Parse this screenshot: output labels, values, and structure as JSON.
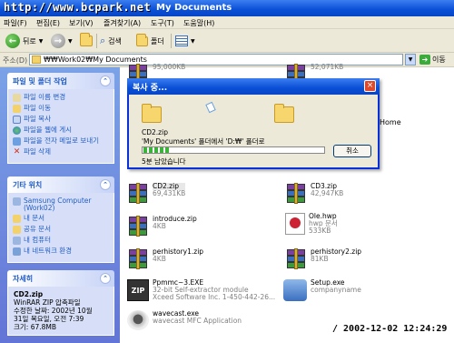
{
  "window": {
    "watermark": "http://www.bcpark.net",
    "title": "My Documents"
  },
  "menu": [
    "파일(F)",
    "편집(E)",
    "보기(V)",
    "즐겨찾기(A)",
    "도구(T)",
    "도움말(H)"
  ],
  "toolbar": {
    "back_label": "뒤로",
    "search_label": "검색",
    "folders_label": "폴더"
  },
  "address": {
    "label": "주소(D)",
    "value": "₩₩Work02₩My Documents",
    "go_label": "이동"
  },
  "left_pane": {
    "tasks": {
      "title": "파일 및 폴더 작업",
      "items": [
        "파일 이름 변경",
        "파일 이동",
        "파일 복사",
        "파일을 웹에 게시",
        "파일을 전자 메일로 보내기",
        "파일 삭제"
      ]
    },
    "other_places": {
      "title": "기타 위치",
      "items": [
        "Samsung Computer (Work02)",
        "내 문서",
        "공유 문서",
        "내 컴퓨터",
        "내 네트워크 환경"
      ]
    },
    "details": {
      "title": "자세히",
      "file_name": "CD2.zip",
      "type": "WinRAR ZIP 압축파일",
      "modified_label": "수정한 날짜: 2002년 10월",
      "modified_time": "31일 목요일, 오전 7:39",
      "size": "크기: 67.8MB"
    }
  },
  "files": [
    {
      "name": "",
      "sub1": "95,000KB",
      "icon": "rar"
    },
    {
      "name": "",
      "sub1": "52,071KB",
      "icon": "rar"
    },
    {
      "name": "CD2.zip",
      "sub1": "69,431KB",
      "icon": "rar"
    },
    {
      "name": "CD3.zip",
      "sub1": "42,947KB",
      "icon": "rar"
    },
    {
      "name": "introduce.zip",
      "sub1": "4KB",
      "icon": "rar"
    },
    {
      "name": "Ole.hwp",
      "sub1": "hwp 문서",
      "sub2": "533KB",
      "icon": "hwp"
    },
    {
      "name": "perhistory1.zip",
      "sub1": "4KB",
      "icon": "rar"
    },
    {
      "name": "perhistory2.zip",
      "sub1": "81KB",
      "icon": "rar"
    },
    {
      "name": "Ppmmc~3.EXE",
      "sub1": "32-bit Self-extractor module",
      "sub2": "Xceed Software Inc.      1-450-442-26...",
      "icon": "zip"
    },
    {
      "name": "Setup.exe",
      "sub1": "companyname",
      "icon": "setup"
    },
    {
      "name": "wavecast.exe",
      "sub1": "wavecast MFC Application",
      "icon": "cam"
    }
  ],
  "visible_fragment": "Home",
  "dialog": {
    "title": "복사 중...",
    "close": "×",
    "file": "CD2.zip",
    "path": "'My Documents' 폴더에서 'D:₩' 폴더로",
    "progress": 0.14,
    "remaining": "5분 남았습니다",
    "cancel": "취소"
  },
  "timestamp": "/ 2002-12-02 12:24:29"
}
